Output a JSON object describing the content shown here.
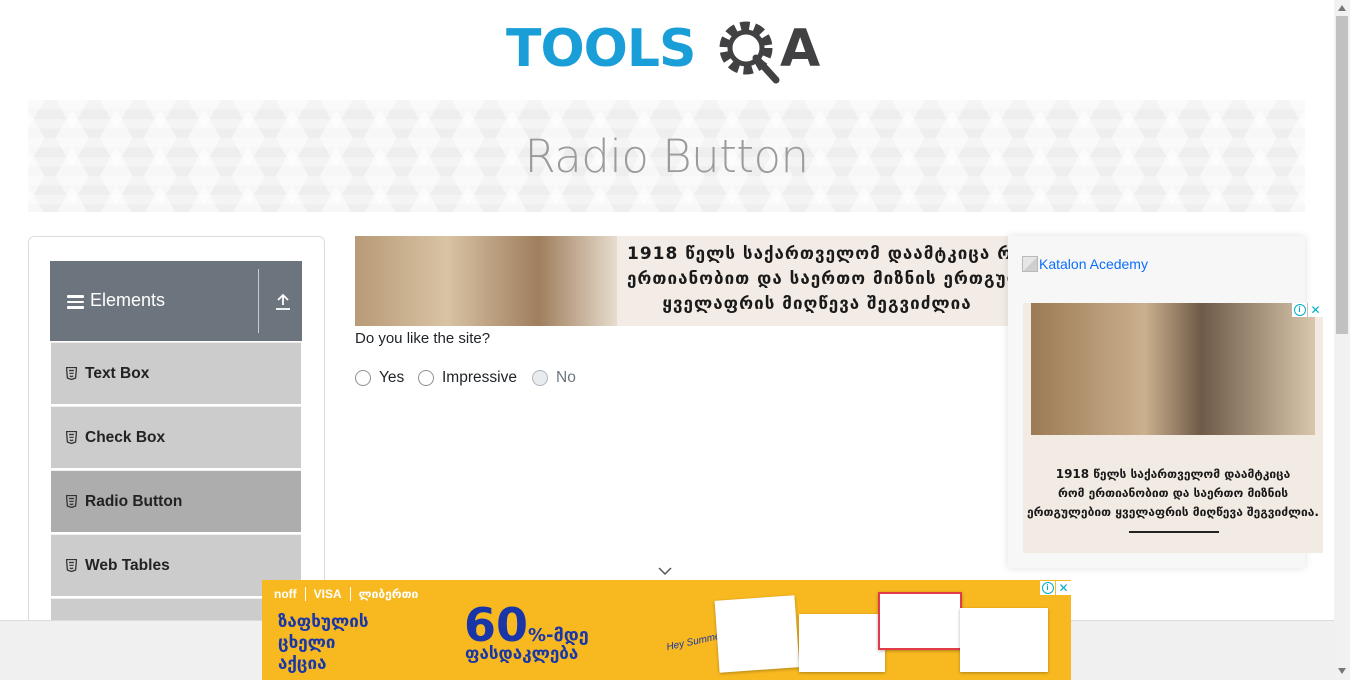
{
  "logo": {
    "text_left": "TOOLS",
    "text_right": "A",
    "alt": "ToolsQA"
  },
  "banner": {
    "title": "Radio Button"
  },
  "sidebar": {
    "group": {
      "label": "Elements"
    },
    "items": [
      {
        "label": "Text Box",
        "active": false
      },
      {
        "label": "Check Box",
        "active": false
      },
      {
        "label": "Radio Button",
        "active": true
      },
      {
        "label": "Web Tables",
        "active": false
      }
    ]
  },
  "ad_top": {
    "line1": "1918 წელს საქართველომ დაამტკიცა რ",
    "line2": "ერთიანობით და საერთო მიზნის ერთგულ",
    "line3": "ყველაფრის მიღწევა შეგვიძლია"
  },
  "form": {
    "question": "Do you like the site?",
    "options": [
      {
        "label": "Yes",
        "disabled": false
      },
      {
        "label": "Impressive",
        "disabled": false
      },
      {
        "label": "No",
        "disabled": true
      }
    ]
  },
  "ad_right": {
    "link_text": "Katalon Acedemy",
    "line1": "1918 წელს საქართველომ დაამტკიცა",
    "line2": "რომ ერთიანობით და საერთო მიზნის",
    "line3": "ერთგულებით ყველაფრის მიღწევა შეგვიძლია."
  },
  "ad_bottom": {
    "brand1": "noff",
    "brand2": "VISA",
    "brand3": "ლიბერთი",
    "slogan1": "ზაფხულის",
    "slogan2": "ცხელი",
    "slogan3": "აქცია",
    "percent": "60",
    "percent_suffix": "%-მდე",
    "discount": "ფასდაკლება",
    "hey": "Hey Summer!"
  },
  "icons": {
    "close": "✕",
    "info": "i"
  },
  "colors": {
    "logo_blue": "#1a9ed8",
    "logo_dark": "#414042",
    "sidebar_header": "#6c757d",
    "ad_yellow": "#f8b920",
    "link_blue": "#0d6efd"
  }
}
